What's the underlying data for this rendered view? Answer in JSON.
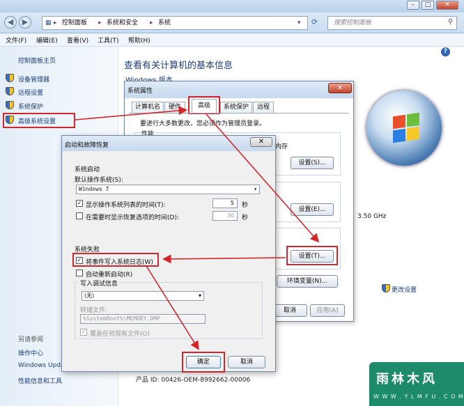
{
  "titlebar": {
    "minimize": "–",
    "maximize": "□",
    "close": "✕"
  },
  "address": {
    "crumbs": [
      "控制面板",
      "系统和安全",
      "系统"
    ],
    "separator": "▸",
    "search_placeholder": "搜索控制面板"
  },
  "menubar": [
    "文件(F)",
    "编辑(E)",
    "查看(V)",
    "工具(T)",
    "帮助(H)"
  ],
  "leftpane": {
    "home": "控制面板主页",
    "items": [
      "设备管理器",
      "远程设置",
      "系统保护",
      "高级系统设置"
    ],
    "see_also_title": "另请参阅",
    "see_also": [
      "操作中心",
      "Windows Update",
      "性能信息和工具"
    ]
  },
  "main": {
    "title": "查看有关计算机的基本信息",
    "windows_edition_label": "Windows 版本",
    "cpu_speed": "3.50 GHz",
    "change_settings": "更改设置",
    "product_id": "产品 ID: 00426-OEM-8992662-00006"
  },
  "sysprop": {
    "title": "系统属性",
    "tabs": [
      "计算机名",
      "硬件",
      "高级",
      "系统保护",
      "远程"
    ],
    "admin_note": "要进行大多数更改，您必须作为管理员登录。",
    "perf_label": "性能",
    "mem_label": "内存",
    "settings_btn": "设置(S)...",
    "settings_btn2": "设置(E)...",
    "settings_btn3": "设置(T)...",
    "env_btn": "环境变量(N)...",
    "cancel": "取消",
    "apply": "应用(A)"
  },
  "startup": {
    "title": "启动和故障恢复",
    "system_startup": "系统启动",
    "default_os_label": "默认操作系统(S):",
    "default_os": "Windows 7",
    "show_list_label": "显示操作系统列表的时间(T):",
    "show_list_value": "5",
    "show_recovery_label": "在需要时显示恢复选项的时间(D):",
    "show_recovery_value": "30",
    "seconds": "秒",
    "system_failure": "系统失败",
    "write_event": "将事件写入系统日志(W)",
    "auto_restart": "自动重新启动(R)",
    "debug_info": "写入调试信息",
    "debug_type": "(无)",
    "dump_file_label": "转储文件:",
    "dump_file": "%SystemRoot%\\MEMORY.DMP",
    "overwrite": "覆盖任何现有文件(O)",
    "ok": "确定",
    "cancel": "取消"
  },
  "watermark": {
    "text": "雨林木风",
    "url": "W W W . Y L M F U . C O M"
  },
  "colors": {
    "highlight_red": "#d0262c",
    "link_blue": "#1a3d7a",
    "title_blue": "#1e3c78"
  }
}
